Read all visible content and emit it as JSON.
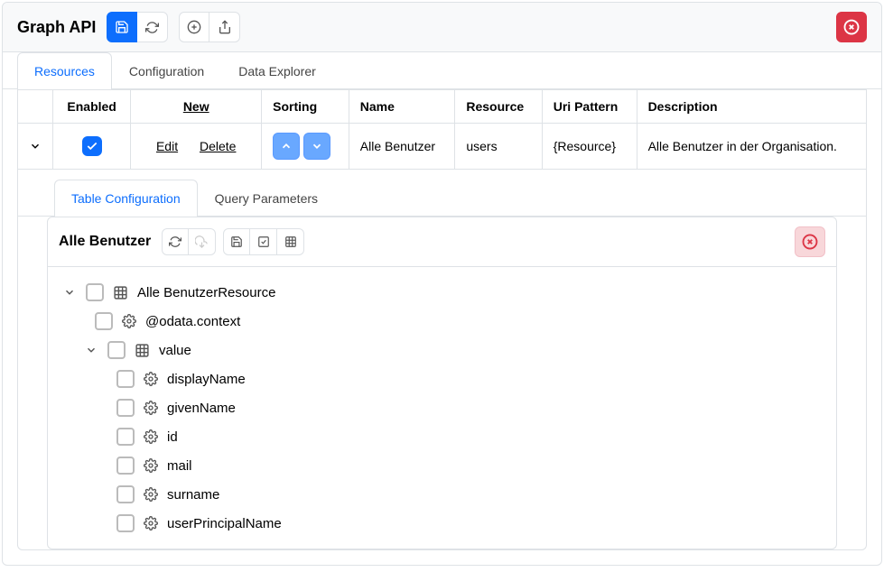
{
  "header": {
    "title": "Graph API"
  },
  "tabs": {
    "resources": "Resources",
    "configuration": "Configuration",
    "dataExplorer": "Data Explorer"
  },
  "grid": {
    "columns": {
      "enabled": "Enabled",
      "new": "New",
      "sorting": "Sorting",
      "name": "Name",
      "resource": "Resource",
      "uriPattern": "Uri Pattern",
      "description": "Description"
    },
    "rows": [
      {
        "enabled": true,
        "editLabel": "Edit",
        "deleteLabel": "Delete",
        "name": "Alle Benutzer",
        "resource": "users",
        "uriPattern": "{Resource}",
        "description": "Alle Benutzer in der Organisation."
      }
    ]
  },
  "detailTabs": {
    "tableConfiguration": "Table Configuration",
    "queryParameters": "Query Parameters"
  },
  "configPanel": {
    "title": "Alle Benutzer"
  },
  "tree": {
    "root": "Alle BenutzerResource",
    "items": [
      {
        "label": "@odata.context",
        "type": "prop"
      },
      {
        "label": "value",
        "type": "node",
        "children": [
          {
            "label": "displayName"
          },
          {
            "label": "givenName"
          },
          {
            "label": "id"
          },
          {
            "label": "mail"
          },
          {
            "label": "surname"
          },
          {
            "label": "userPrincipalName"
          }
        ]
      }
    ]
  }
}
